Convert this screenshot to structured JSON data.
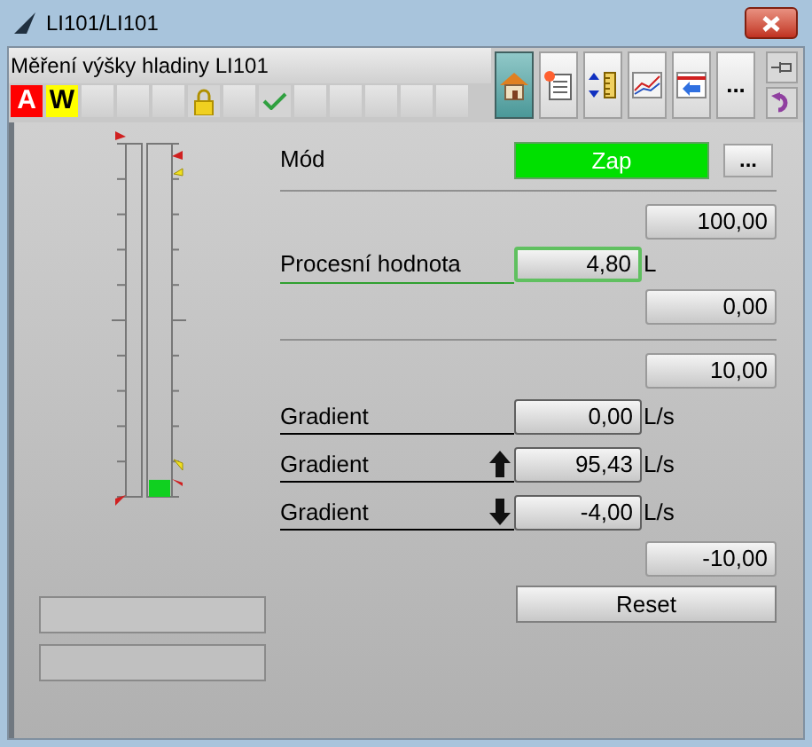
{
  "window": {
    "title": "LI101/LI101"
  },
  "header": {
    "title": "Měření výšky hladiny LI101"
  },
  "indicators": [
    {
      "kind": "letter",
      "label": "A",
      "color": "#ff0000"
    },
    {
      "kind": "letter",
      "label": "W",
      "color": "#ffff00"
    },
    {
      "kind": "empty"
    },
    {
      "kind": "empty"
    },
    {
      "kind": "empty"
    },
    {
      "kind": "lock"
    },
    {
      "kind": "empty"
    },
    {
      "kind": "check"
    },
    {
      "kind": "empty"
    },
    {
      "kind": "empty"
    },
    {
      "kind": "empty"
    },
    {
      "kind": "empty"
    },
    {
      "kind": "empty"
    }
  ],
  "toolbar": [
    {
      "kind": "home",
      "selected": true
    },
    {
      "kind": "document",
      "selected": false
    },
    {
      "kind": "scale",
      "selected": false
    },
    {
      "kind": "trend",
      "selected": false
    },
    {
      "kind": "return",
      "selected": false
    },
    {
      "kind": "more",
      "label": "...",
      "selected": false
    }
  ],
  "gauge": {
    "level": 0.048
  },
  "mode": {
    "label": "Mód",
    "value": "Zap",
    "on": true,
    "more": "..."
  },
  "process": {
    "high": "100,00",
    "label": "Procesní hodnota",
    "value": "4,80",
    "unit": "L",
    "low": "0,00"
  },
  "gradient": {
    "high": "10,00",
    "rows": [
      {
        "label": "Gradient",
        "kind": "plain",
        "value": "0,00",
        "unit": "L/s"
      },
      {
        "label": "Gradient",
        "kind": "up",
        "value": "95,43",
        "unit": "L/s"
      },
      {
        "label": "Gradient",
        "kind": "down",
        "value": "-4,00",
        "unit": "L/s"
      }
    ],
    "low": "-10,00"
  },
  "reset": "Reset"
}
